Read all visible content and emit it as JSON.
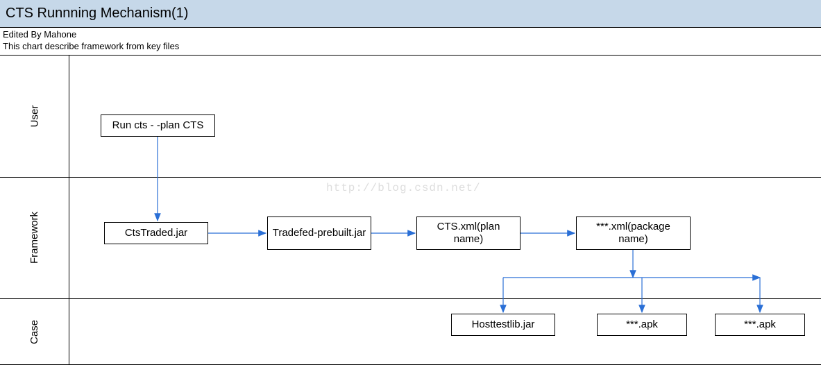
{
  "title": "CTS Runnning Mechanism(1)",
  "header_line1": "Edited By Mahone",
  "header_line2": "This chart describe framework from key files",
  "watermark": "http://blog.csdn.net/",
  "lanes": {
    "user": "User",
    "framework": "Framework",
    "case": "Case"
  },
  "nodes": {
    "run_cmd": "Run cts - -plan CTS",
    "cts_traded": "CtsTraded.jar",
    "tradefed": "Tradefed-prebuilt.jar",
    "cts_xml": "CTS.xml(plan name)",
    "pkg_xml": "***.xml(package name)",
    "hosttestlib": "Hosttestlib.jar",
    "apk1": "***.apk",
    "apk2": "***.apk"
  }
}
